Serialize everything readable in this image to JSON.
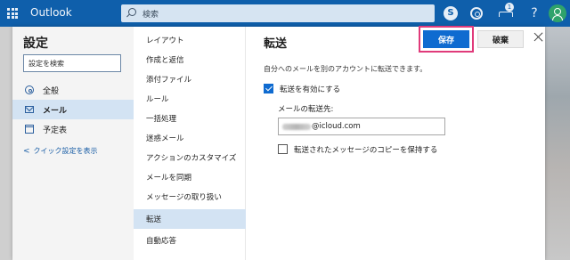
{
  "topbar": {
    "app_name": "Outlook",
    "search_placeholder": "検索",
    "notification_count": "1",
    "help_label": "?"
  },
  "nav": {
    "title": "設定",
    "search_placeholder": "設定を検索",
    "items": [
      {
        "label": "全般",
        "icon": "gear-icon"
      },
      {
        "label": "メール",
        "icon": "mail-icon"
      },
      {
        "label": "予定表",
        "icon": "calendar-icon"
      }
    ],
    "quick_settings": "クイック設定を表示"
  },
  "submenu": {
    "items": [
      "レイアウト",
      "作成と返信",
      "添付ファイル",
      "ルール",
      "一括処理",
      "迷惑メール",
      "アクションのカスタマイズ",
      "メールを同期",
      "メッセージの取り扱い",
      "転送",
      "自動応答"
    ]
  },
  "content": {
    "title": "転送",
    "save_label": "保存",
    "discard_label": "破棄",
    "description": "自分へのメールを別のアカウントに転送できます。",
    "enable_label": "転送を有効にする",
    "forward_to_label": "メールの転送先:",
    "forward_to_value": "@icloud.com",
    "keep_copy_label": "転送されたメッセージのコピーを保持する"
  },
  "state": {
    "selected_nav": "メール",
    "selected_submenu": "転送",
    "forwarding_enabled": true,
    "keep_copy": false
  }
}
